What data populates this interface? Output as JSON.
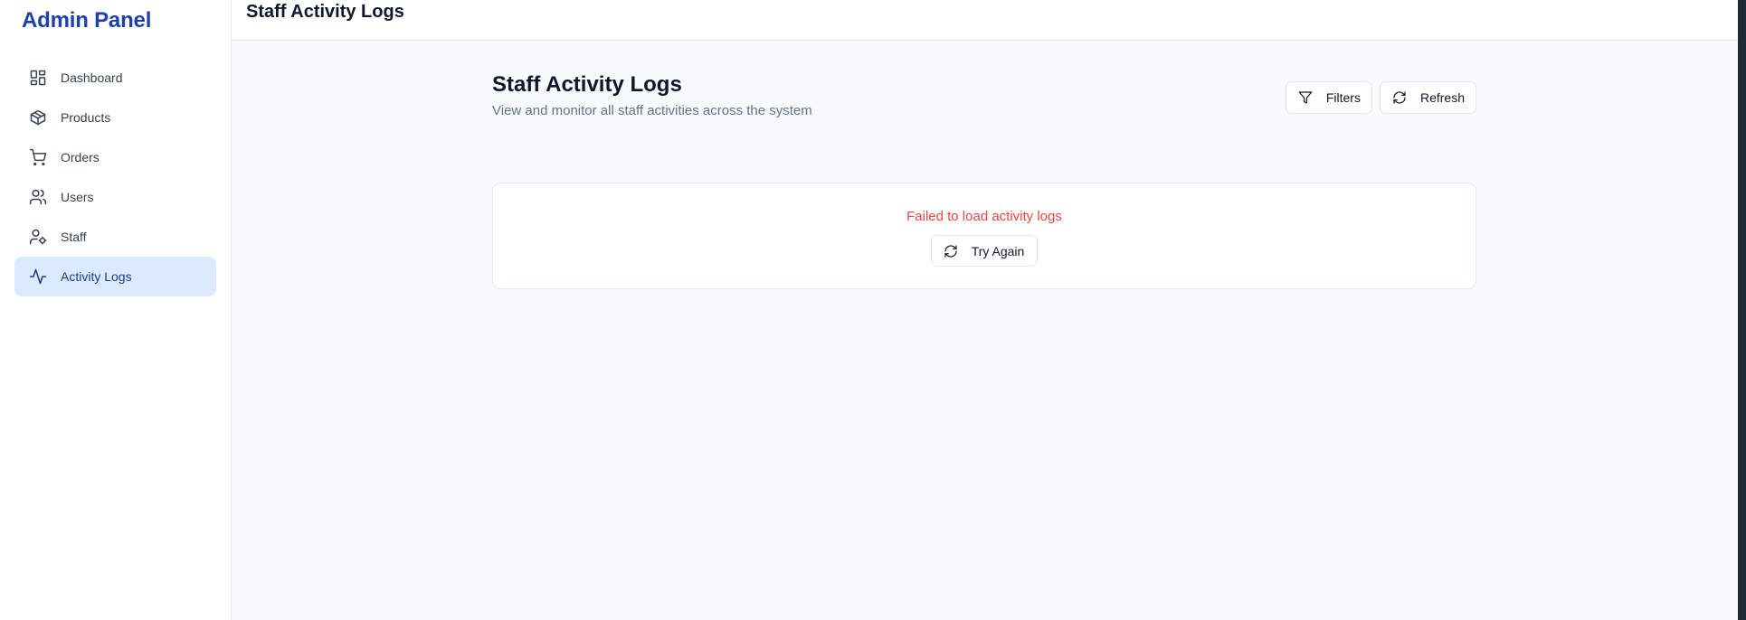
{
  "sidebar": {
    "brand": "Admin Panel",
    "items": [
      {
        "label": "Dashboard",
        "icon": "dashboard-icon"
      },
      {
        "label": "Products",
        "icon": "box-icon"
      },
      {
        "label": "Orders",
        "icon": "cart-icon"
      },
      {
        "label": "Users",
        "icon": "users-icon"
      },
      {
        "label": "Staff",
        "icon": "user-cog-icon"
      },
      {
        "label": "Activity Logs",
        "icon": "activity-icon",
        "active": true
      }
    ]
  },
  "header": {
    "title": "Staff Activity Logs"
  },
  "main": {
    "title": "Staff Activity Logs",
    "subtitle": "View and monitor all staff activities across the system",
    "filters_label": "Filters",
    "refresh_label": "Refresh",
    "error_message": "Failed to load activity logs",
    "retry_label": "Try Again"
  },
  "colors": {
    "brand": "#1e40af",
    "active_bg": "#dbeafe",
    "error": "#ef4444",
    "main_bg": "#f8fafc"
  }
}
